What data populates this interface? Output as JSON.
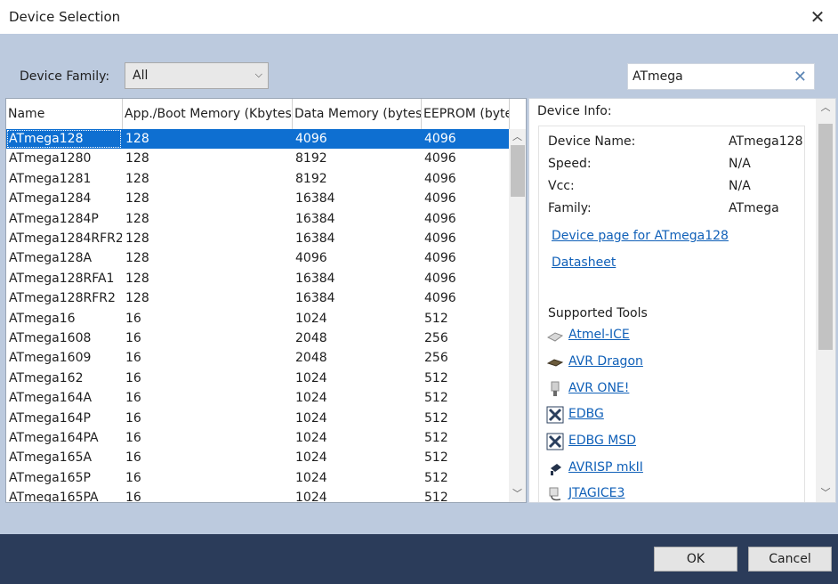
{
  "window": {
    "title": "Device Selection"
  },
  "filter": {
    "family_label": "Device Family:",
    "family_value": "All",
    "search_value": "ATmega"
  },
  "grid": {
    "columns": [
      "Name",
      "App./Boot Memory (Kbytes)",
      "Data Memory (bytes)",
      "EEPROM (byte"
    ],
    "rows": [
      [
        "ATmega128",
        "128",
        "4096",
        "4096"
      ],
      [
        "ATmega1280",
        "128",
        "8192",
        "4096"
      ],
      [
        "ATmega1281",
        "128",
        "8192",
        "4096"
      ],
      [
        "ATmega1284",
        "128",
        "16384",
        "4096"
      ],
      [
        "ATmega1284P",
        "128",
        "16384",
        "4096"
      ],
      [
        "ATmega1284RFR2",
        "128",
        "16384",
        "4096"
      ],
      [
        "ATmega128A",
        "128",
        "4096",
        "4096"
      ],
      [
        "ATmega128RFA1",
        "128",
        "16384",
        "4096"
      ],
      [
        "ATmega128RFR2",
        "128",
        "16384",
        "4096"
      ],
      [
        "ATmega16",
        "16",
        "1024",
        "512"
      ],
      [
        "ATmega1608",
        "16",
        "2048",
        "256"
      ],
      [
        "ATmega1609",
        "16",
        "2048",
        "256"
      ],
      [
        "ATmega162",
        "16",
        "1024",
        "512"
      ],
      [
        "ATmega164A",
        "16",
        "1024",
        "512"
      ],
      [
        "ATmega164P",
        "16",
        "1024",
        "512"
      ],
      [
        "ATmega164PA",
        "16",
        "1024",
        "512"
      ],
      [
        "ATmega165A",
        "16",
        "1024",
        "512"
      ],
      [
        "ATmega165P",
        "16",
        "1024",
        "512"
      ],
      [
        "ATmega165PA",
        "16",
        "1024",
        "512"
      ]
    ],
    "selected_index": 0
  },
  "info": {
    "title": "Device Info:",
    "fields": [
      {
        "label": "Device Name:",
        "value": "ATmega128"
      },
      {
        "label": "Speed:",
        "value": "N/A"
      },
      {
        "label": "Vcc:",
        "value": "N/A"
      },
      {
        "label": "Family:",
        "value": "ATmega"
      }
    ],
    "device_page_link": "Device page for ATmega128",
    "datasheet_link": "Datasheet",
    "tools_title": "Supported Tools",
    "tools": [
      {
        "name": "Atmel-ICE",
        "icon": "atmel-ice-icon"
      },
      {
        "name": "AVR Dragon",
        "icon": "avr-dragon-icon"
      },
      {
        "name": "AVR ONE!",
        "icon": "avr-one-icon"
      },
      {
        "name": "EDBG",
        "icon": "edbg-icon"
      },
      {
        "name": "EDBG MSD",
        "icon": "edbg-msd-icon"
      },
      {
        "name": "AVRISP mkII",
        "icon": "avrisp-icon"
      },
      {
        "name": "JTAGICE3",
        "icon": "jtagice3-icon"
      }
    ]
  },
  "buttons": {
    "ok": "OK",
    "cancel": "Cancel"
  },
  "colors": {
    "selection": "#0e6fd1",
    "link": "#1060b8",
    "footer": "#2b3c5a",
    "background": "#bccade"
  }
}
